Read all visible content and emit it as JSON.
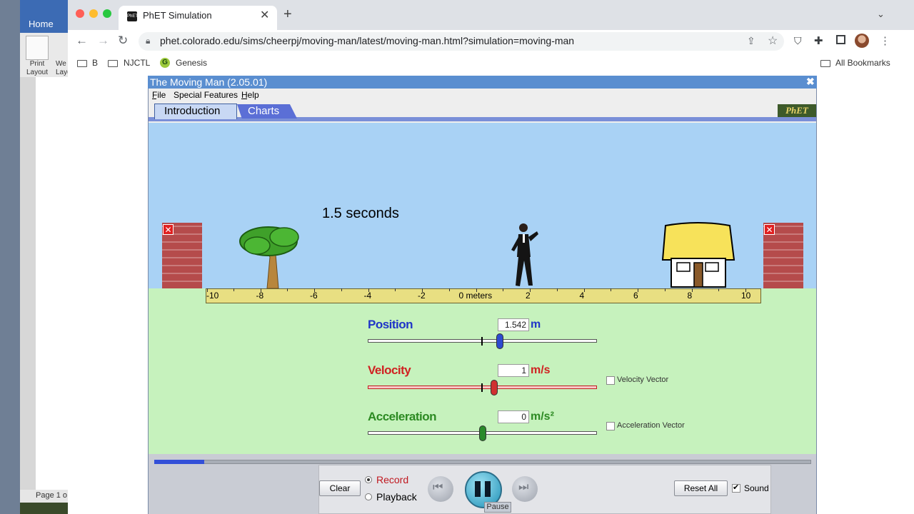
{
  "word": {
    "ribbon_tab": "Home",
    "print_layout_label": "Print Layout",
    "web_layout_label": "We Layo",
    "status_text": "Page 1 o"
  },
  "browser": {
    "tab_title": "PhET Simulation",
    "favicon_text": "PhET",
    "url": "phet.colorado.edu/sims/cheerpj/moving-man/latest/moving-man.html?simulation=moving-man",
    "bookmarks": [
      "B",
      "NJCTL",
      "Genesis"
    ],
    "all_bookmarks": "All Bookmarks",
    "genesis_letter": "G"
  },
  "sim": {
    "window_title": "The Moving Man (2.05.01)",
    "menus": [
      "File",
      "Special Features",
      "Help"
    ],
    "tabs": [
      "Introduction",
      "Charts"
    ],
    "logo_text": "PhET",
    "time_readout": "1.5 seconds",
    "ruler_ticks": [
      "-10",
      "-8",
      "-6",
      "-4",
      "-2",
      "0 meters",
      "2",
      "4",
      "6",
      "8",
      "10"
    ],
    "position": {
      "label": "Position",
      "value": "1.542",
      "unit": "m",
      "color": "#1f35c8",
      "knob_color": "#2d4ad0",
      "slider_fraction": 0.577
    },
    "velocity": {
      "label": "Velocity",
      "value": "1",
      "unit": "m/s",
      "color": "#d02222",
      "knob_color": "#d03030",
      "slider_fraction": 0.55,
      "vector_label": "Velocity Vector",
      "vector_checked": false
    },
    "acceleration": {
      "label": "Acceleration",
      "value": "0",
      "unit": "m/s²",
      "color": "#2c8a22",
      "knob_color": "#2a8a2a",
      "slider_fraction": 0.5,
      "vector_label": "Acceleration Vector",
      "vector_checked": false
    },
    "progress_fraction": 0.076,
    "clear_label": "Clear",
    "record_label": "Record",
    "playback_label": "Playback",
    "mode_selected": "Record",
    "pause_tooltip": "Pause",
    "reset_label": "Reset All",
    "sound_label": "Sound",
    "sound_checked": true
  }
}
